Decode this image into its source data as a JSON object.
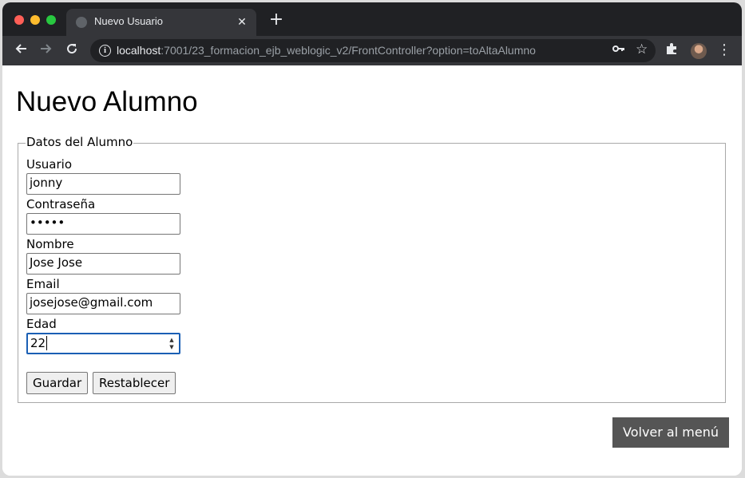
{
  "browser": {
    "tab_title": "Nuevo Usuario",
    "close_glyph": "✕",
    "new_tab_glyph": "+",
    "url_host": "localhost",
    "url_path": ":7001/23_formacion_ejb_weblogic_v2/FrontController?option=toAltaAlumno",
    "icons": [
      "back-arrow-icon",
      "forward-arrow-icon",
      "reload-icon",
      "info-icon",
      "key-icon",
      "star-icon",
      "puzzle-icon",
      "avatar",
      "kebab-menu-icon"
    ]
  },
  "page": {
    "title": "Nuevo Alumno",
    "legend": "Datos del Alumno",
    "fields": [
      {
        "label": "Usuario",
        "value": "jonny",
        "type": "text"
      },
      {
        "label": "Contraseña",
        "value": "•••••",
        "type": "password"
      },
      {
        "label": "Nombre",
        "value": "Jose Jose",
        "type": "text"
      },
      {
        "label": "Email",
        "value": "josejose@gmail.com",
        "type": "email"
      },
      {
        "label": "Edad",
        "value": "22",
        "type": "number"
      }
    ],
    "buttons": {
      "save": "Guardar",
      "reset": "Restablecer"
    },
    "back_button": "Volver al menú"
  },
  "colors": {
    "accent_focus": "#1a5fb4",
    "back_button_bg": "#555555",
    "browser_dark": "#202124"
  }
}
